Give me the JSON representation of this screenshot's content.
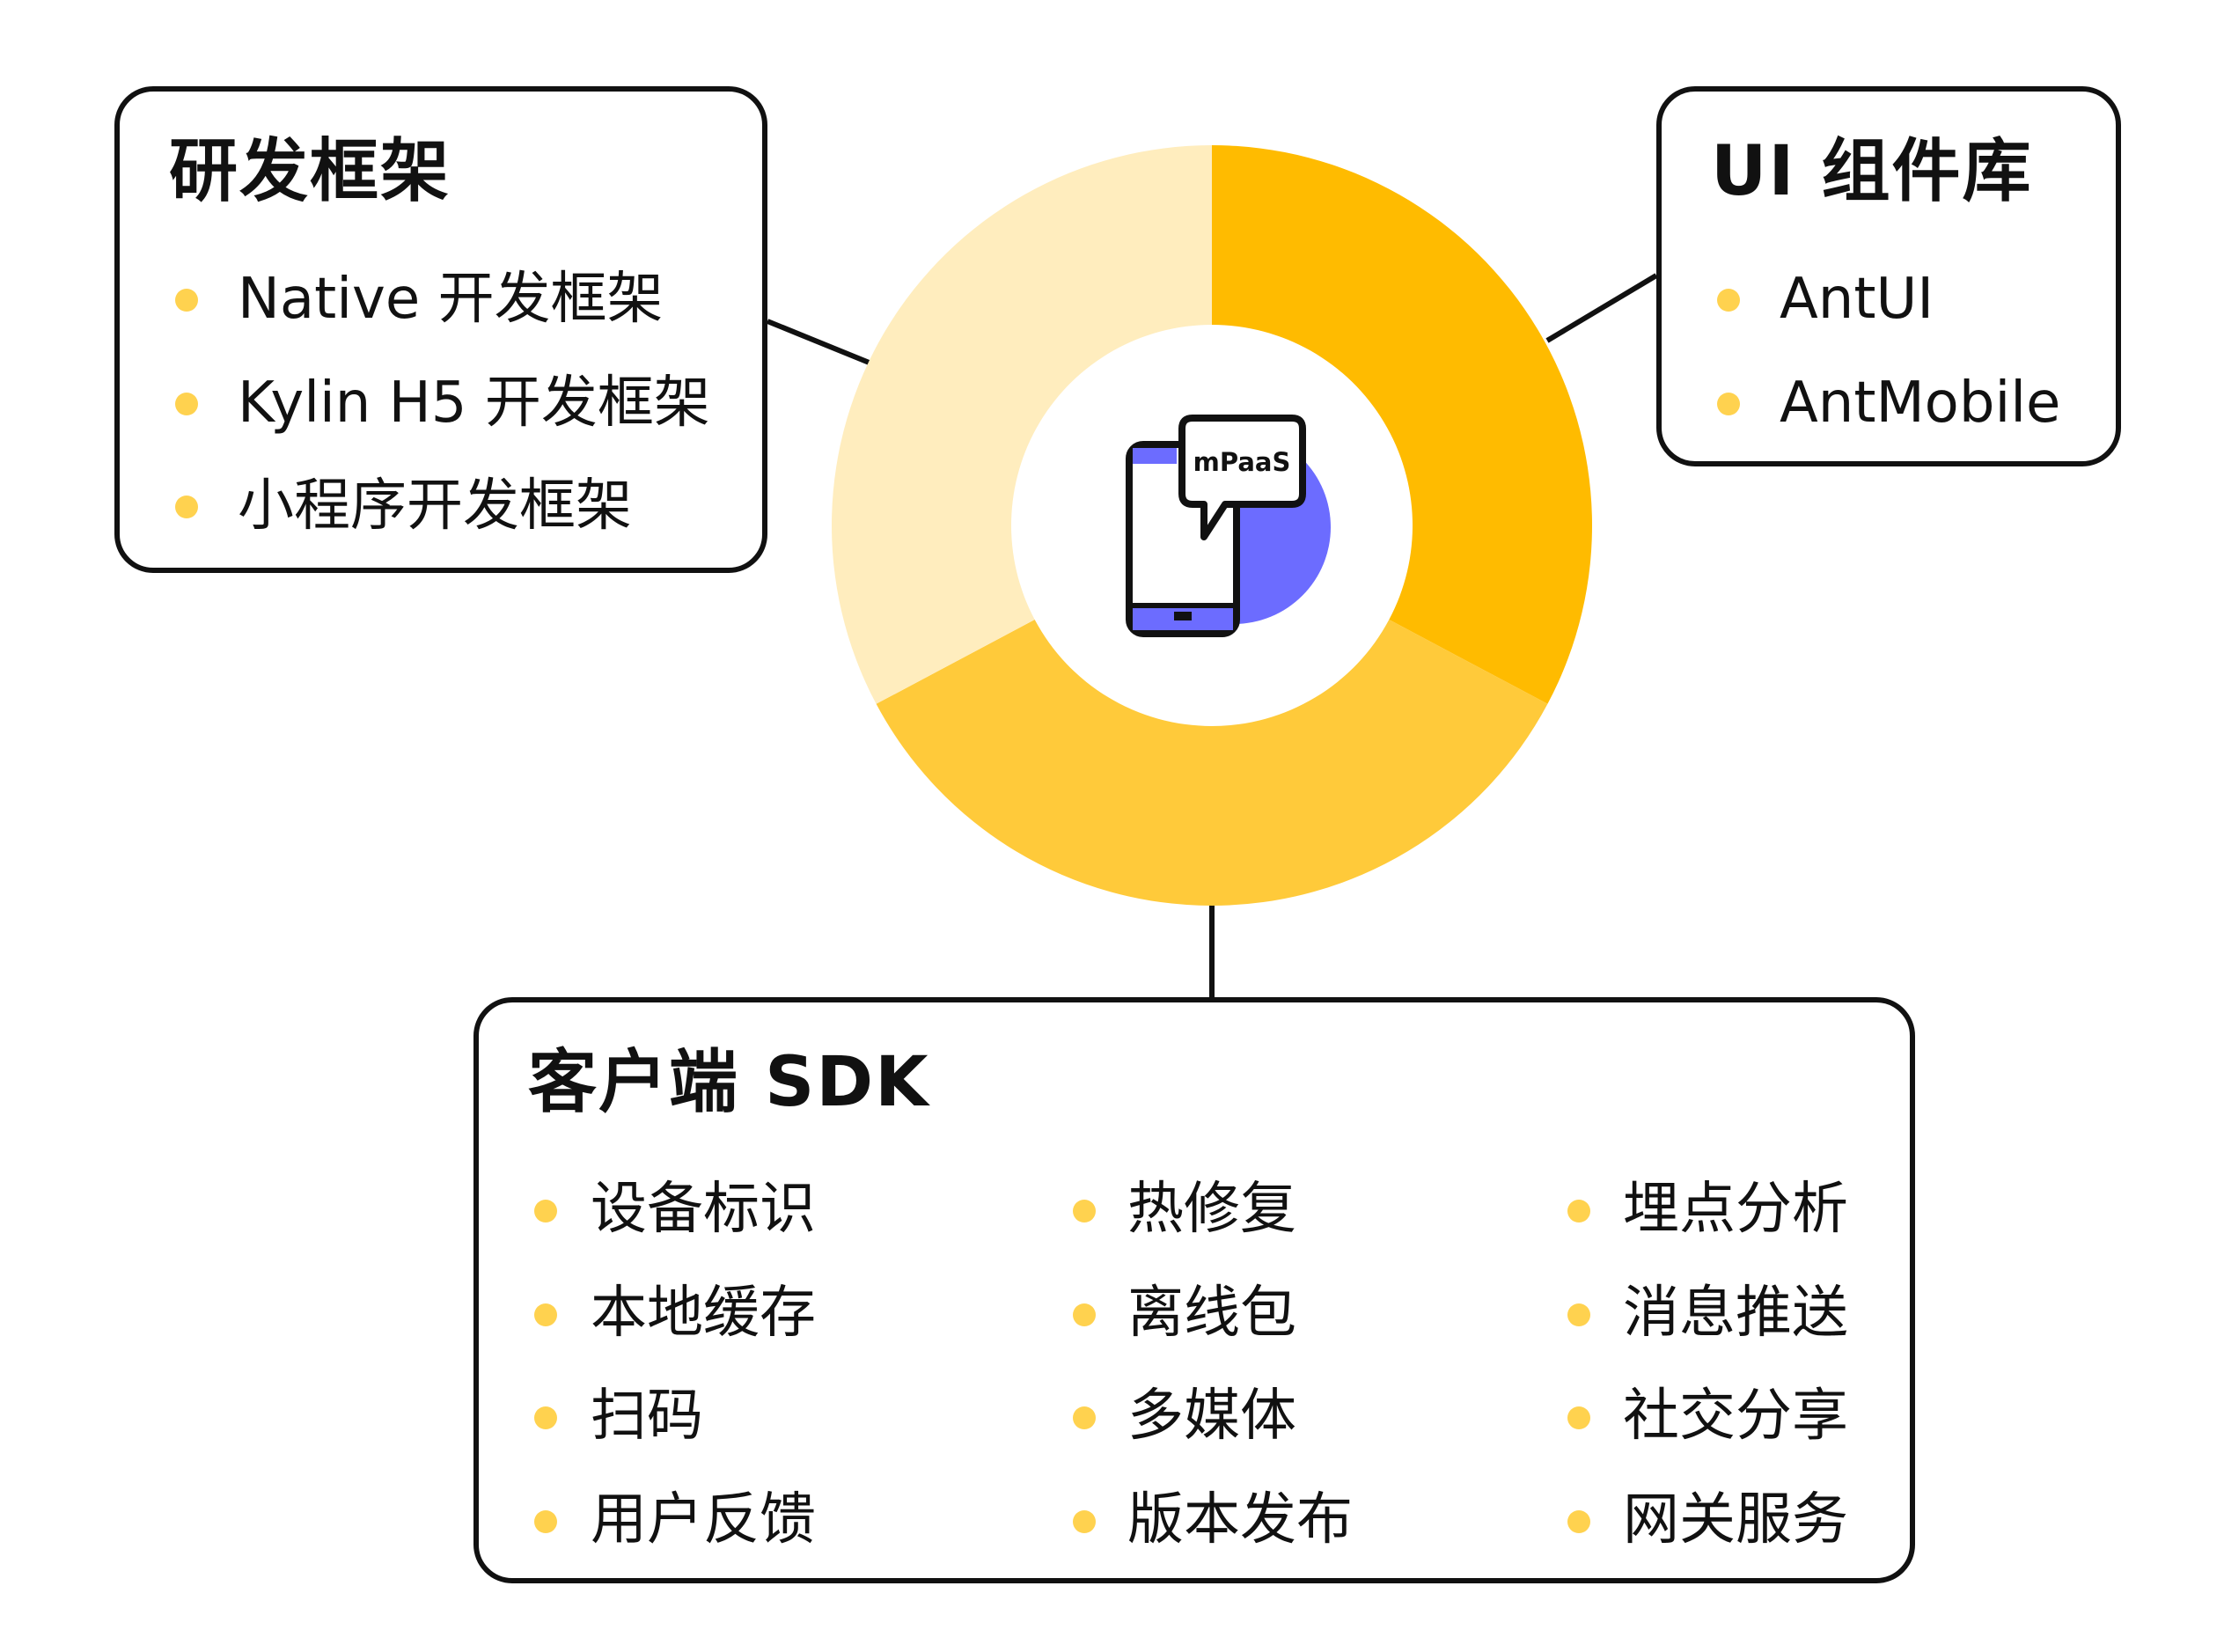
{
  "colors": {
    "segment_top_right": "#FFBB00",
    "segment_bottom": "#FFCA3A",
    "segment_left": "#FFEDBE",
    "accent_purple": "#6C6CFF",
    "bullet": "#FFD24F",
    "outline": "#111111"
  },
  "center": {
    "icon": "phone-with-speech-bubble-icon",
    "label": "mPaaS"
  },
  "boxes": {
    "dev_framework": {
      "title": "研发框架",
      "items": [
        "Native 开发框架",
        "Kylin H5 开发框架",
        "小程序开发框架"
      ]
    },
    "ui_library": {
      "title": "UI 组件库",
      "items": [
        "AntUI",
        "AntMobile"
      ]
    },
    "client_sdk": {
      "title": "客户端 SDK",
      "columns": [
        [
          "设备标识",
          "本地缓存",
          "扫码",
          "用户反馈"
        ],
        [
          "热修复",
          "离线包",
          "多媒体",
          "版本发布"
        ],
        [
          "埋点分析",
          "消息推送",
          "社交分享",
          "网关服务"
        ]
      ]
    }
  }
}
